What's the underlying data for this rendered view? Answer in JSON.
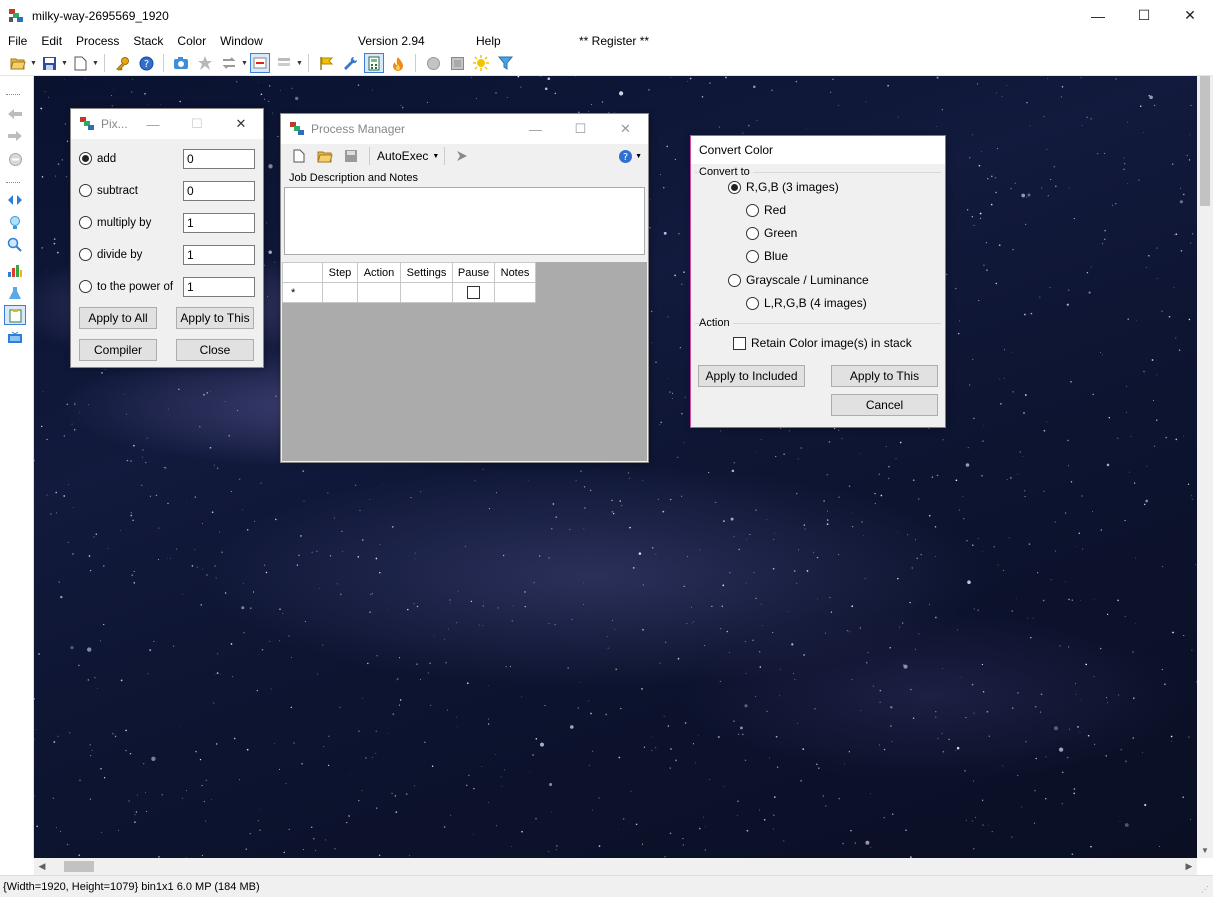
{
  "window": {
    "title": "milky-way-2695569_1920",
    "minimize": "—",
    "maximize": "☐",
    "close": "✕"
  },
  "menu": {
    "file": "File",
    "edit": "Edit",
    "process": "Process",
    "stack": "Stack",
    "color": "Color",
    "window": "Window",
    "version": "Version 2.94",
    "help": "Help",
    "register": "** Register **"
  },
  "pixel_math": {
    "title": "Pix...",
    "ops": [
      {
        "label": "add",
        "value": "0",
        "selected": true
      },
      {
        "label": "subtract",
        "value": "0",
        "selected": false
      },
      {
        "label": "multiply by",
        "value": "1",
        "selected": false
      },
      {
        "label": "divide by",
        "value": "1",
        "selected": false
      },
      {
        "label": "to the power of",
        "value": "1",
        "selected": false
      }
    ],
    "apply_all": "Apply to All",
    "apply_this": "Apply to This",
    "compiler": "Compiler",
    "close": "Close"
  },
  "process_manager": {
    "title": "Process Manager",
    "autoexec": "AutoExec",
    "notes_label": "Job Description and Notes",
    "columns": [
      "",
      "Step",
      "Action",
      "Settings",
      "Pause",
      "Notes"
    ],
    "new_row_marker": "*"
  },
  "convert_color": {
    "title": "Convert Color",
    "convert_to": "Convert to",
    "rgb3": "R,G,B (3 images)",
    "red": "Red",
    "green": "Green",
    "blue": "Blue",
    "gray": "Grayscale / Luminance",
    "lrgb": "L,R,G,B (4 images)",
    "action": "Action",
    "retain": "Retain Color image(s) in stack",
    "apply_included": "Apply to Included",
    "apply_this": "Apply to This",
    "cancel": "Cancel"
  },
  "status": {
    "text": "{Width=1920, Height=1079} bin1x1  6.0 MP (184 MB)"
  },
  "colors": {
    "accent": "#1e6fd9",
    "dialog_border_highlight": "#d24aa8"
  },
  "icons": {
    "toolbar": [
      "open-folder-icon",
      "save-icon",
      "new-document-icon",
      "key-icon",
      "help-icon",
      "camera-icon",
      "star-icon",
      "swap-icon",
      "minus-icon",
      "stack-icon",
      "flag-icon",
      "wrench-icon",
      "calculator-icon",
      "flame-icon",
      "circle-icon",
      "square-icon",
      "sun-icon",
      "filter-icon"
    ]
  }
}
